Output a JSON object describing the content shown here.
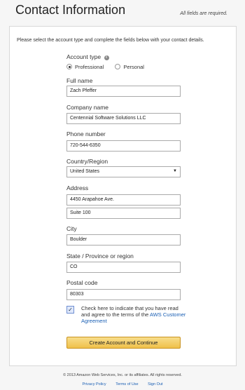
{
  "header": {
    "title": "Contact Information",
    "required_note": "All fields are required."
  },
  "intro": "Please select the account type and complete the fields below with your contact details.",
  "account_type": {
    "label": "Account type",
    "options": [
      {
        "label": "Professional",
        "selected": true
      },
      {
        "label": "Personal",
        "selected": false
      }
    ]
  },
  "fields": {
    "full_name": {
      "label": "Full name",
      "value": "Zach Pfeffer"
    },
    "company": {
      "label": "Company name",
      "value": "Centennial Software Solutions LLC"
    },
    "phone": {
      "label": "Phone number",
      "value": "720-544-6350"
    },
    "country": {
      "label": "Country/Region",
      "value": "United States"
    },
    "address": {
      "label": "Address",
      "line1": "4450 Arapahoe Ave.",
      "line2": "Suite 100"
    },
    "city": {
      "label": "City",
      "value": "Boulder"
    },
    "state": {
      "label": "State / Province or region",
      "value": "CO"
    },
    "postal": {
      "label": "Postal code",
      "value": "80303"
    }
  },
  "agreement": {
    "checked": true,
    "text": "Check here to indicate that you have read and agree to the terms of the ",
    "link": "AWS Customer Agreement"
  },
  "submit_label": "Create Account and Continue",
  "footer": {
    "copyright": "© 2013 Amazon Web Services, Inc. or its affiliates. All rights reserved.",
    "links": [
      "Privacy Policy",
      "Terms of Use",
      "Sign Out"
    ]
  },
  "colors": {
    "link": "#1a5fb4",
    "button_top": "#f8de8c",
    "button_bottom": "#efc04a"
  },
  "icons": {
    "info": "info-icon",
    "dropdown": "caret-down-icon",
    "check": "checkmark-icon"
  }
}
